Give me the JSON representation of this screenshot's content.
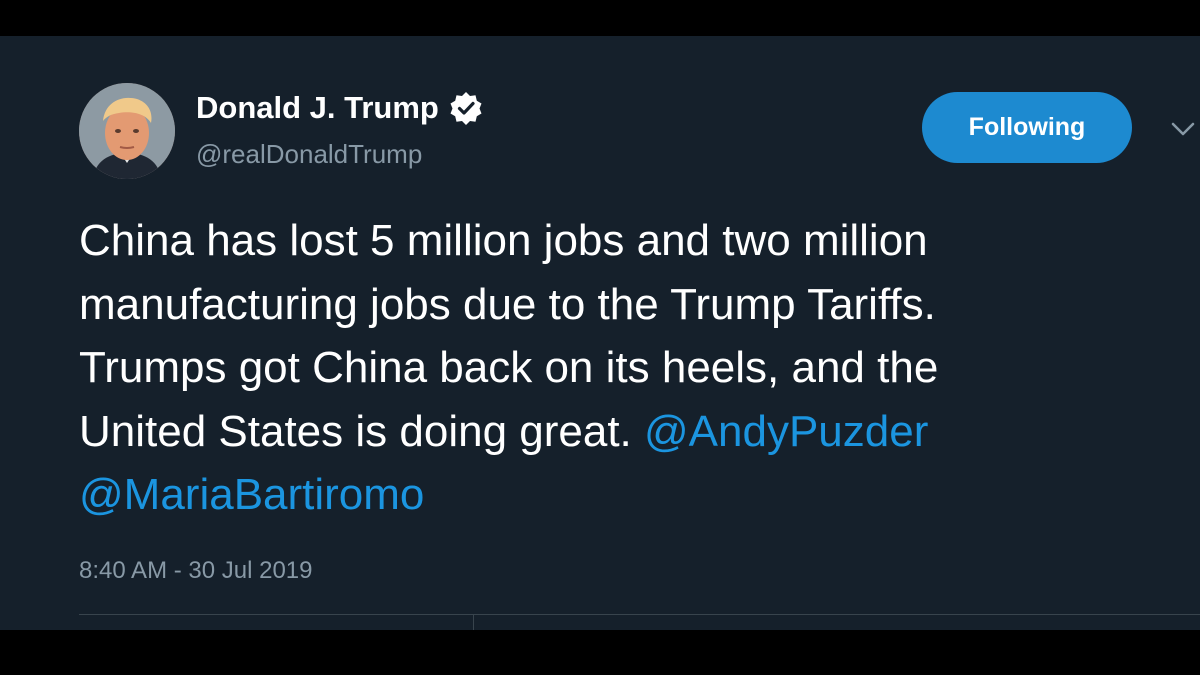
{
  "tweet": {
    "author": {
      "name": "Donald J. Trump",
      "handle": "@realDonaldTrump",
      "verified": true,
      "avatar_icon": "profile-photo"
    },
    "follow_button": {
      "label": "Following",
      "color": "#1d8ad0"
    },
    "menu_icon": "chevron-down-icon",
    "text_lines": [
      "China has lost 5 million jobs and two million",
      "manufacturing jobs due to the Trump Tariffs.",
      "Trumps got China back on its heels, and the",
      "United States is doing great. "
    ],
    "mentions": [
      "@AndyPuzder",
      "@MariaBartiromo"
    ],
    "timestamp": "8:40 AM - 30 Jul 2019",
    "colors": {
      "background": "#15202b",
      "mention": "#1b95e0",
      "secondary_text": "#8899a6",
      "letterbox": "#000000"
    }
  }
}
